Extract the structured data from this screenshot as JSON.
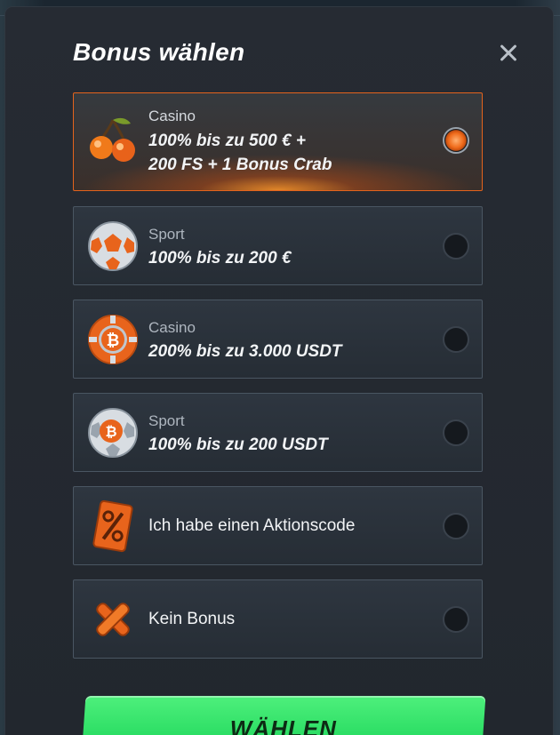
{
  "modal": {
    "title": "Bonus wählen",
    "close_label": "Schließen"
  },
  "options": [
    {
      "category": "Casino",
      "title_line1": "100% bis zu 500 € +",
      "title_line2": "200 FS + 1 Bonus Crab",
      "icon": "cherries-icon",
      "selected": true
    },
    {
      "category": "Sport",
      "title_line1": "100% bis zu 200 €",
      "icon": "soccer-ball-icon",
      "selected": false
    },
    {
      "category": "Casino",
      "title_line1": "200% bis zu 3.000 USDT",
      "icon": "bitcoin-chip-icon",
      "selected": false
    },
    {
      "category": "Sport",
      "title_line1": "100% bis zu 200 USDT",
      "icon": "bitcoin-soccer-ball-icon",
      "selected": false
    },
    {
      "label": "Ich habe einen Aktionscode",
      "icon": "percent-coupon-icon",
      "selected": false
    },
    {
      "label": "Kein Bonus",
      "icon": "cross-icon",
      "selected": false
    }
  ],
  "cta": {
    "label": "WÄHLEN"
  },
  "colors": {
    "accent": "#e4631c",
    "cta": "#2ee366",
    "panel": "#262b33"
  }
}
